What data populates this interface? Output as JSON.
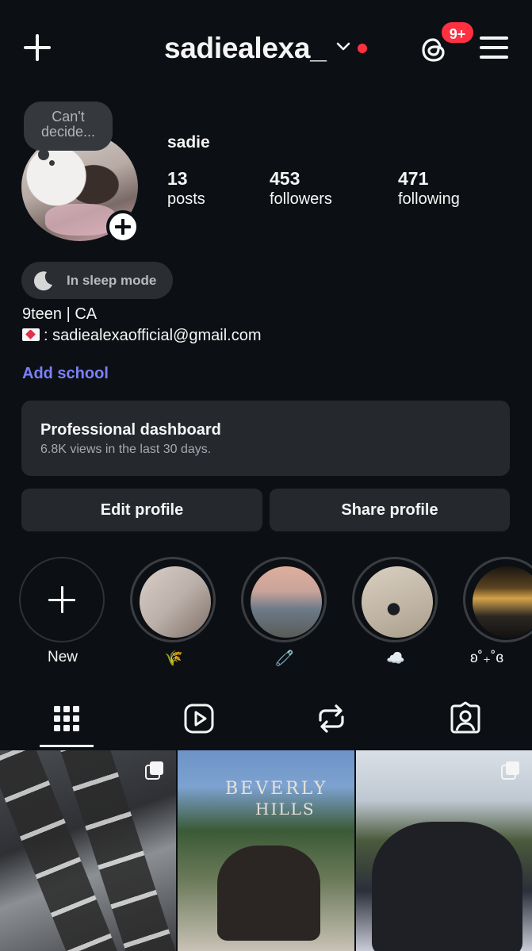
{
  "header": {
    "username": "sadiealexa_",
    "notification_badge": "9+",
    "accent_red": "#ff3040"
  },
  "profile": {
    "note": "Can't decide...",
    "display_name": "sadie",
    "stats": [
      {
        "value": "13",
        "label": "posts"
      },
      {
        "value": "453",
        "label": "followers"
      },
      {
        "value": "471",
        "label": "following"
      }
    ],
    "status_pill": "In sleep mode",
    "bio_line_1": "9teen | CA",
    "bio_line_2": ": sadiealexaofficial@gmail.com",
    "add_school": "Add school",
    "link_color": "#7b82f7"
  },
  "dashboard": {
    "title": "Professional dashboard",
    "subtitle": "6.8K views in the last 30 days."
  },
  "actions": {
    "edit_label": "Edit profile",
    "share_label": "Share profile"
  },
  "highlights": [
    {
      "label": "New"
    },
    {
      "label": "🌾"
    },
    {
      "label": "🧷"
    },
    {
      "label": "☁️"
    },
    {
      "label": "ʚ˚₊˚ɞ"
    }
  ],
  "tabs": [
    {
      "icon": "grid-icon",
      "active": true
    },
    {
      "icon": "reels-icon",
      "active": false
    },
    {
      "icon": "reposts-icon",
      "active": false
    },
    {
      "icon": "tagged-icon",
      "active": false
    }
  ],
  "grid": {
    "post_2_sign": "BEVERLY",
    "post_2_sign_2": "HILLS"
  }
}
